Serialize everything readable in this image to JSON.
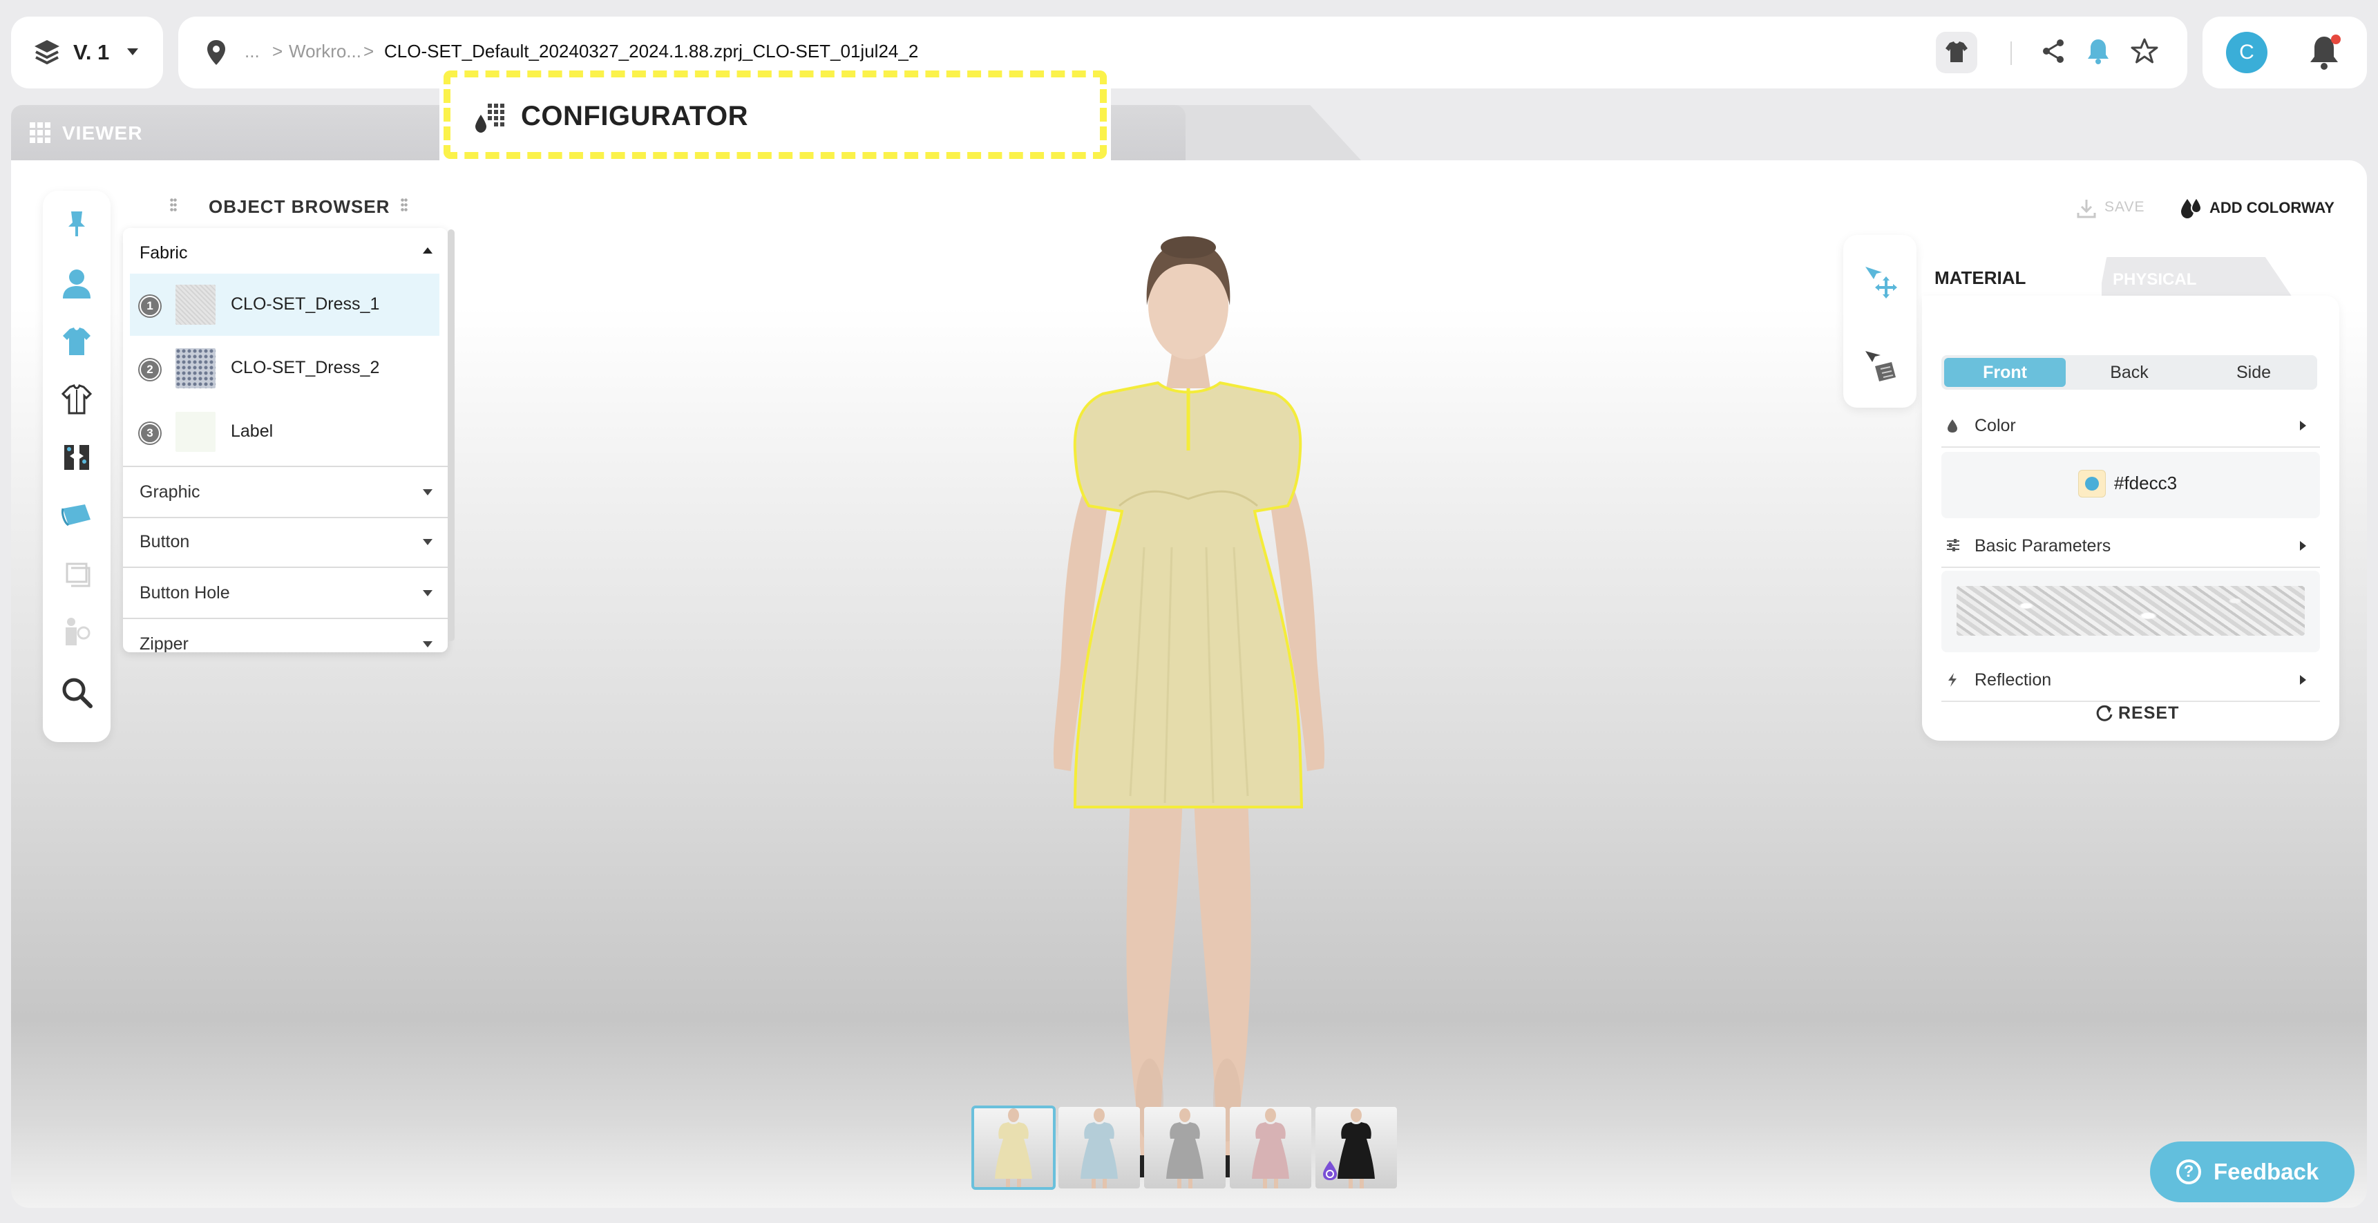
{
  "version": {
    "label": "V. 1"
  },
  "breadcrumb": {
    "ellipsis": "...",
    "separator": ">",
    "folder": "Workro...",
    "filename": "CLO-SET_Default_20240327_2024.1.88.zprj_CLO-SET_01jul24_2"
  },
  "user": {
    "initial": "C"
  },
  "tabs": {
    "viewer": "VIEWER",
    "configurator": "CONFIGURATOR"
  },
  "object_browser": {
    "title": "OBJECT BROWSER",
    "sections": [
      {
        "label": "Fabric",
        "expanded": true
      },
      {
        "label": "Graphic"
      },
      {
        "label": "Button"
      },
      {
        "label": "Button Hole"
      },
      {
        "label": "Zipper"
      }
    ],
    "fabrics": [
      {
        "num": "1",
        "name": "CLO-SET_Dress_1",
        "selected": true
      },
      {
        "num": "2",
        "name": "CLO-SET_Dress_2"
      },
      {
        "num": "3",
        "name": "Label"
      }
    ]
  },
  "actions": {
    "save": "SAVE",
    "add_colorway": "ADD COLORWAY"
  },
  "material_panel": {
    "tab_material": "MATERIAL",
    "tab_physical": "PHYSICAL",
    "sides": [
      "Front",
      "Back",
      "Side"
    ],
    "active_side": "Front",
    "color_label": "Color",
    "color_value": "#fdecc3",
    "basic_params_label": "Basic Parameters",
    "reflection_label": "Reflection",
    "reset": "RESET"
  },
  "colorways": {
    "colors": [
      "#e9dfb0",
      "#b4cdd8",
      "#a5a5a5",
      "#d7b2b4",
      "#1a1a1a"
    ],
    "selected_index": 0
  },
  "feedback": {
    "label": "Feedback"
  },
  "theme": {
    "accent": "#6ac0dc",
    "highlight": "#fbf24a",
    "dress": "#e5dcab"
  }
}
